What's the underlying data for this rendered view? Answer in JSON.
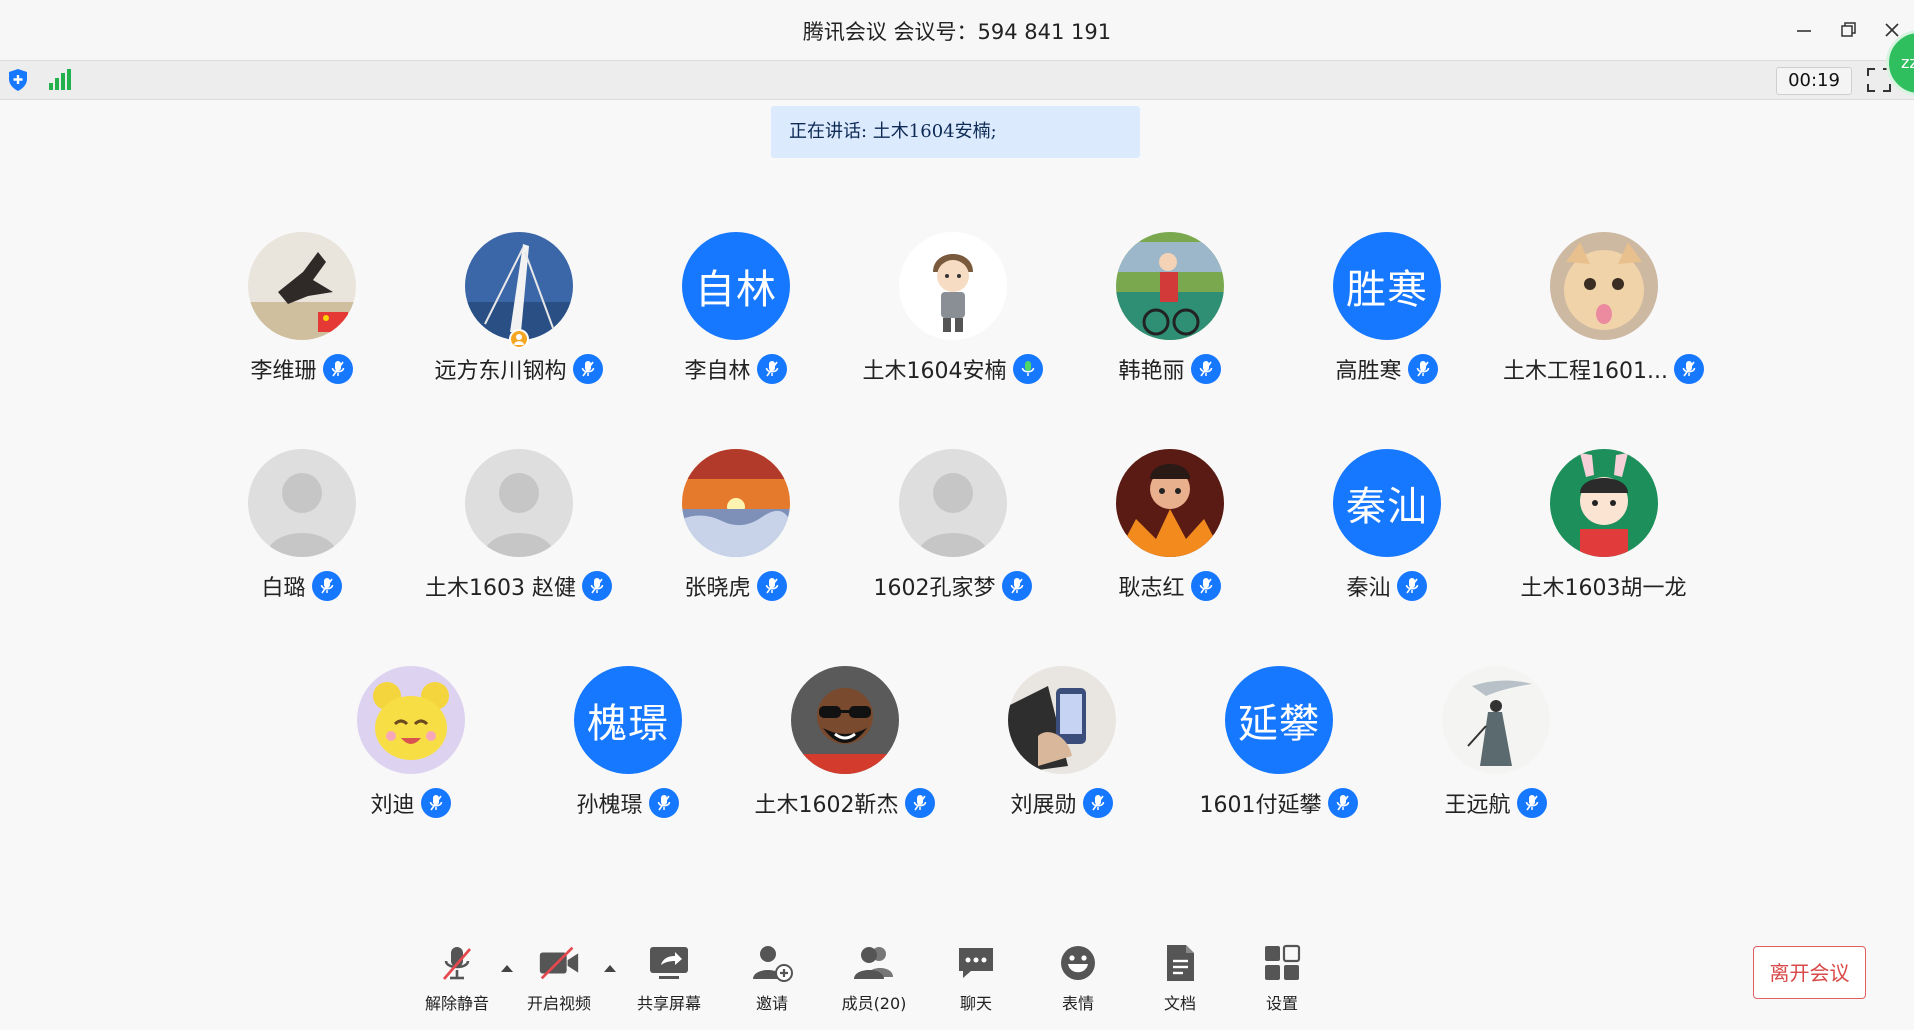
{
  "window": {
    "title": "腾讯会议 会议号：594 841 191",
    "timer": "00:19",
    "corner_avatar_text": "zz"
  },
  "speaking_banner": "正在讲话: 土木1604安楠;",
  "participants": [
    {
      "name": "李维珊",
      "avatar": "photo-cat-flag",
      "mic": "muted"
    },
    {
      "name": "远方东川钢构",
      "avatar": "photo-bridge",
      "mic": "muted",
      "host": true
    },
    {
      "name": "李自林",
      "avatar": "initials",
      "initials": "自林",
      "mic": "muted"
    },
    {
      "name": "土木1604安楠",
      "avatar": "cartoon-boy",
      "mic": "speaking"
    },
    {
      "name": "韩艳丽",
      "avatar": "photo-bike",
      "mic": "muted"
    },
    {
      "name": "高胜寒",
      "avatar": "initials",
      "initials": "胜寒",
      "mic": "muted"
    },
    {
      "name": "土木工程1601...",
      "avatar": "photo-cat",
      "mic": "muted"
    },
    {
      "name": "白璐",
      "avatar": "default",
      "mic": "muted"
    },
    {
      "name": "土木1603 赵健",
      "avatar": "default",
      "mic": "muted"
    },
    {
      "name": "张晓虎",
      "avatar": "photo-sunset",
      "mic": "muted"
    },
    {
      "name": "1602孔家梦",
      "avatar": "default",
      "mic": "muted"
    },
    {
      "name": "耿志红",
      "avatar": "cartoon-nezha",
      "mic": "muted"
    },
    {
      "name": "秦汕",
      "avatar": "initials",
      "initials": "秦汕",
      "mic": "muted"
    },
    {
      "name": "土木1603胡一龙",
      "avatar": "cartoon-bunny",
      "mic": "none"
    },
    {
      "name": "刘迪",
      "avatar": "cartoon-yellow",
      "mic": "muted"
    },
    {
      "name": "孙槐璟",
      "avatar": "initials",
      "initials": "槐璟",
      "mic": "muted"
    },
    {
      "name": "土木1602靳杰",
      "avatar": "cartoon-sunglasses",
      "mic": "muted"
    },
    {
      "name": "刘展勋",
      "avatar": "photo-phone",
      "mic": "muted"
    },
    {
      "name": "1601付延攀",
      "avatar": "initials",
      "initials": "延攀",
      "mic": "muted"
    },
    {
      "name": "王远航",
      "avatar": "photo-ink",
      "mic": "muted"
    }
  ],
  "toolbar": {
    "unmute": "解除静音",
    "start_video": "开启视频",
    "share_screen": "共享屏幕",
    "invite": "邀请",
    "members": "成员(20)",
    "chat": "聊天",
    "emoji": "表情",
    "docs": "文档",
    "settings": "设置",
    "leave": "离开会议"
  },
  "colors": {
    "accent": "#1677ff",
    "speaking_bg": "#dceafd",
    "leave_red": "#d94848",
    "mic_active_green": "#4cd964"
  }
}
